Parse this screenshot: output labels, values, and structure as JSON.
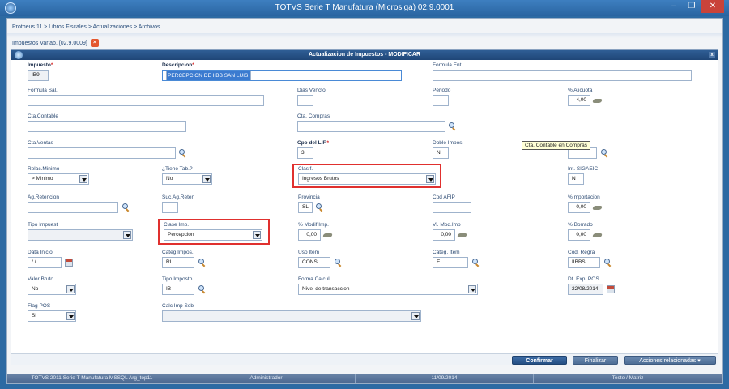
{
  "window": {
    "title": "TOTVS Serie T Manufatura (Microsiga) 02.9.0001"
  },
  "breadcrumb": "Protheus 11 > Libros Fiscales > Actualizaciones > Archivos",
  "tab": {
    "label": "Impuestos Variab. [02.9.0009]"
  },
  "dialog": {
    "title": "Actualizacion de Impuestos - MODIFICAR",
    "close": "x"
  },
  "fields": {
    "impuesto": {
      "label": "Impuesto",
      "value": "IB9"
    },
    "descripcion": {
      "label": "Descripcion",
      "value": "PERCEPCION DE IIBB SAN LUIS."
    },
    "formula_ent": {
      "label": "Formula Ent.",
      "value": ""
    },
    "formula_sal": {
      "label": "Formula Sal.",
      "value": ""
    },
    "dias_vencto": {
      "label": "Dias Vencto",
      "value": ""
    },
    "periodo": {
      "label": "Periodo",
      "value": ""
    },
    "alicuota": {
      "label": "% Alicuota",
      "value": "4,00"
    },
    "cta_contable": {
      "label": "Cta.Contable",
      "value": ""
    },
    "cta_compras": {
      "label": "Cta. Compras",
      "value": ""
    },
    "cta_ventas": {
      "label": "Cta.Ventas",
      "value": ""
    },
    "cpo_lf": {
      "label": "Cpo del L.F.",
      "value": "3"
    },
    "doble_impos": {
      "label": "Doble Impos.",
      "value": "N"
    },
    "relac_minimo": {
      "label": "Relac.Minimo",
      "value": "> Minimo"
    },
    "tiene_tab": {
      "label": "¿Tiene Tab.?",
      "value": "No"
    },
    "clasif": {
      "label": "Clasif.",
      "value": "Ingresos Brutos"
    },
    "int_sigaeic": {
      "label": "Int. SIGAEIC",
      "value": "N"
    },
    "ag_retencion": {
      "label": "Ag.Retencion",
      "value": ""
    },
    "suc_ag_reten": {
      "label": "Suc.Ag.Reten",
      "value": ""
    },
    "provincia": {
      "label": "Provincia",
      "value": "SL"
    },
    "cod_afip": {
      "label": "Cod AFIP",
      "value": ""
    },
    "importacion": {
      "label": "%Importacion",
      "value": "0,00"
    },
    "tipo_impuest": {
      "label": "Tipo Impuest",
      "value": ""
    },
    "clase_imp": {
      "label": "Clase Imp.",
      "value": "Percepcion"
    },
    "modif_imp": {
      "label": "% Modif.Imp.",
      "value": "0,00"
    },
    "vl_mod_imp": {
      "label": "Vl. Mod.Imp",
      "value": "0,00"
    },
    "borrado": {
      "label": "% Borrado",
      "value": "0,00"
    },
    "data_inicio": {
      "label": "Data Inicio",
      "value": " / /"
    },
    "categ_impos": {
      "label": "Categ.Impos.",
      "value": "RI"
    },
    "uso_item": {
      "label": "Uso Item",
      "value": "CONS"
    },
    "categ_item": {
      "label": "Categ. Item",
      "value": "E"
    },
    "cod_regra": {
      "label": "Cod. Regra",
      "value": "IIBBSL"
    },
    "valor_bruto": {
      "label": "Valor Bruto",
      "value": "No"
    },
    "tipo_imposto": {
      "label": "Tipo Imposto",
      "value": "IB"
    },
    "forma_calcul": {
      "label": "Forma Calcul",
      "value": "Nivel de transaccion"
    },
    "dt_exp_pos": {
      "label": "Dt. Exp. POS",
      "value": "22/08/2014"
    },
    "flag_pos": {
      "label": "Flag POS",
      "value": "Si"
    },
    "calc_imp_sob": {
      "label": "Calc Imp Sob",
      "value": ""
    }
  },
  "tooltip": "Cta. Contable en Compras",
  "buttons": {
    "confirm": "Confirmar",
    "finish": "Finalizar",
    "actions": "Acciones relacionadas"
  },
  "status": {
    "product": "TOTVS 2011 Serie T Manufatura MSSQL Arg_top11",
    "user": "Administrador",
    "date": "11/09/2014",
    "company": "Teste / Matriz"
  }
}
